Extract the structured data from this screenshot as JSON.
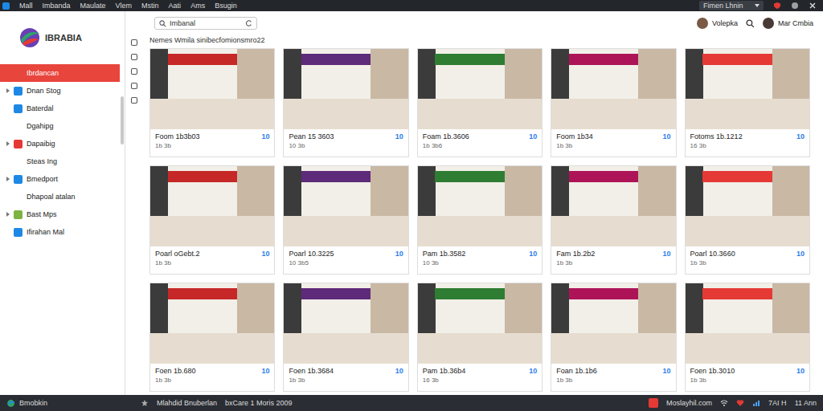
{
  "menubar": {
    "items": [
      "Mall",
      "Imbanda",
      "Maulate",
      "Vlem",
      "Mstin",
      "Aati",
      "Ams",
      "Bsugin"
    ],
    "account": "Fimen Lhnin"
  },
  "logo": {
    "text": "IBRABIA"
  },
  "search": {
    "value": "Imbanal"
  },
  "users": [
    {
      "name": "Volepka"
    },
    {
      "name": "Mar Cmbia"
    }
  ],
  "sidebar": {
    "items": [
      {
        "label": "Ibrdancan",
        "selected": true,
        "expandable": false,
        "color": null
      },
      {
        "label": "Dnan Stog",
        "selected": false,
        "expandable": true,
        "color": "#1e88e5"
      },
      {
        "label": "Baterdal",
        "selected": false,
        "expandable": false,
        "color": "#1e88e5"
      },
      {
        "label": "Dgahipg",
        "selected": false,
        "expandable": false,
        "color": null
      },
      {
        "label": "Dapaibig",
        "selected": false,
        "expandable": true,
        "color": "#e53935"
      },
      {
        "label": "Steas Ing",
        "selected": false,
        "expandable": false,
        "color": null
      },
      {
        "label": "Bmedport",
        "selected": false,
        "expandable": true,
        "color": "#1e88e5"
      },
      {
        "label": "Dhapoal atalan",
        "selected": false,
        "expandable": false,
        "color": null
      },
      {
        "label": "Bast Mps",
        "selected": false,
        "expandable": true,
        "color": "#7cb342"
      },
      {
        "label": "Ifirahan Mal",
        "selected": false,
        "expandable": false,
        "color": "#1e88e5"
      }
    ]
  },
  "heading": "Nemes Wmila sinibecfomionsmro22",
  "cards": [
    {
      "title": "Foom 1b3b03",
      "subtitle": "1b 3b",
      "badge": "10"
    },
    {
      "title": "Pean 15 3603",
      "subtitle": "10 3b",
      "badge": "10"
    },
    {
      "title": "Foam 1b.3606",
      "subtitle": "1b 3b6",
      "badge": "10"
    },
    {
      "title": "Foom 1b34",
      "subtitle": "1b 3b",
      "badge": "10"
    },
    {
      "title": "Fotoms 1b.1212",
      "subtitle": "16 3b",
      "badge": "10"
    },
    {
      "title": "Poarl oGebt.2",
      "subtitle": "1b 3b",
      "badge": "10"
    },
    {
      "title": "Poarl 10.3225",
      "subtitle": "10 3b5",
      "badge": "10"
    },
    {
      "title": "Pam 1b.3582",
      "subtitle": "10 3b",
      "badge": "10"
    },
    {
      "title": "Fam 1b.2b2",
      "subtitle": "1b 3b",
      "badge": "10"
    },
    {
      "title": "Poarl 10.3660",
      "subtitle": "1b 3b",
      "badge": "10"
    },
    {
      "title": "Foen 1b.680",
      "subtitle": "1b 3b",
      "badge": "10"
    },
    {
      "title": "Foen 1b.3684",
      "subtitle": "1b 3b",
      "badge": "10"
    },
    {
      "title": "Pam 1b.36b4",
      "subtitle": "16 3b",
      "badge": "10"
    },
    {
      "title": "Foan 1b.1b6",
      "subtitle": "1b 3b",
      "badge": "10"
    },
    {
      "title": "Foen 1b.3010",
      "subtitle": "1b 3b",
      "badge": "10"
    }
  ],
  "status_bar": {
    "brand": "Bmobkin",
    "items": [
      "Mlahdid Bnuberlan",
      "bxCare 1 Moris 2009"
    ],
    "site": "Moslayhil.com",
    "time": "7AI H",
    "date": "11 Ann"
  }
}
